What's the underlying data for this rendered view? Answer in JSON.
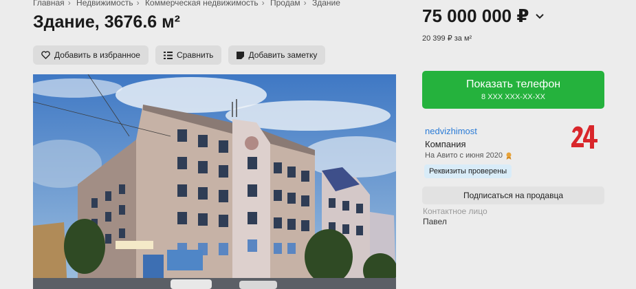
{
  "breadcrumbs": [
    "Главная",
    "Недвижимость",
    "Коммерческая недвижимость",
    "Продам",
    "Здание"
  ],
  "listing": {
    "title": "Здание, 3676.6 м²"
  },
  "actions": {
    "favorite_label": "Добавить в избранное",
    "compare_label": "Сравнить",
    "note_label": "Добавить заметку"
  },
  "price": {
    "value": "75 000 000 ₽",
    "per_unit": "20 399 ₽ за м²"
  },
  "phone_button": {
    "label": "Показать телефон",
    "masked_number": "8 XXX XXX-XX-XX"
  },
  "seller": {
    "name": "nedvizhimost",
    "type": "Компания",
    "since": "На Авито с июня 2020",
    "badge": "Реквизиты проверены",
    "subscribe_label": "Подписаться на продавца",
    "contact_label": "Контактное лицо",
    "contact_name": "Павел"
  },
  "colors": {
    "accent_green": "#25b23d",
    "link_blue": "#2a7bd6",
    "logo_red": "#d9262b"
  },
  "icons": {
    "favorite": "heart-icon",
    "compare": "compare-icon",
    "note": "note-icon",
    "price_toggle": "chevron-down-icon",
    "since": "medal-icon"
  }
}
